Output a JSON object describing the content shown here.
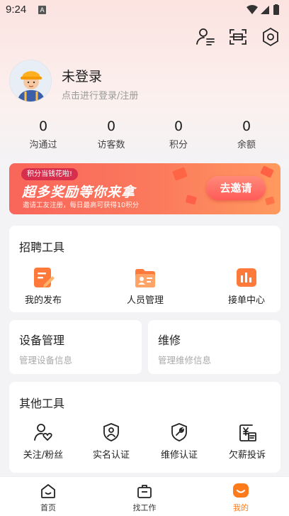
{
  "status_bar": {
    "time": "9:24",
    "notif_letter": "A"
  },
  "header_icons": [
    "user-switch-icon",
    "scan-icon",
    "settings-icon"
  ],
  "profile": {
    "name": "未登录",
    "subtitle": "点击进行登录/注册"
  },
  "stats": [
    {
      "value": "0",
      "label": "沟通过"
    },
    {
      "value": "0",
      "label": "访客数"
    },
    {
      "value": "0",
      "label": "积分"
    },
    {
      "value": "0",
      "label": "余额"
    }
  ],
  "banner": {
    "pill": "积分当钱花啦!",
    "title": "超多奖励等你来拿",
    "subtitle": "邀请工友注册，每日最高可获得10积分",
    "button": "去邀请"
  },
  "recruit": {
    "title": "招聘工具",
    "items": [
      {
        "label": "我的发布",
        "icon": "edit-doc-icon"
      },
      {
        "label": "人员管理",
        "icon": "folder-person-icon"
      },
      {
        "label": "接单中心",
        "icon": "bar-chart-icon"
      }
    ]
  },
  "device": {
    "title": "设备管理",
    "subtitle": "管理设备信息"
  },
  "repair": {
    "title": "维修",
    "subtitle": "管理维修信息"
  },
  "other": {
    "title": "其他工具",
    "items": [
      {
        "label": "关注/粉丝",
        "icon": "user-heart-icon"
      },
      {
        "label": "实名认证",
        "icon": "shield-check-icon"
      },
      {
        "label": "维修认证",
        "icon": "shield-wrench-icon"
      },
      {
        "label": "欠薪投诉",
        "icon": "yen-complaint-icon"
      }
    ]
  },
  "tabs": [
    {
      "label": "首页",
      "icon": "home-icon"
    },
    {
      "label": "找工作",
      "icon": "briefcase-icon"
    },
    {
      "label": "我的",
      "icon": "profile-tab-icon"
    }
  ],
  "colors": {
    "accent": "#ff7a1a",
    "banner": "#f9655a"
  }
}
